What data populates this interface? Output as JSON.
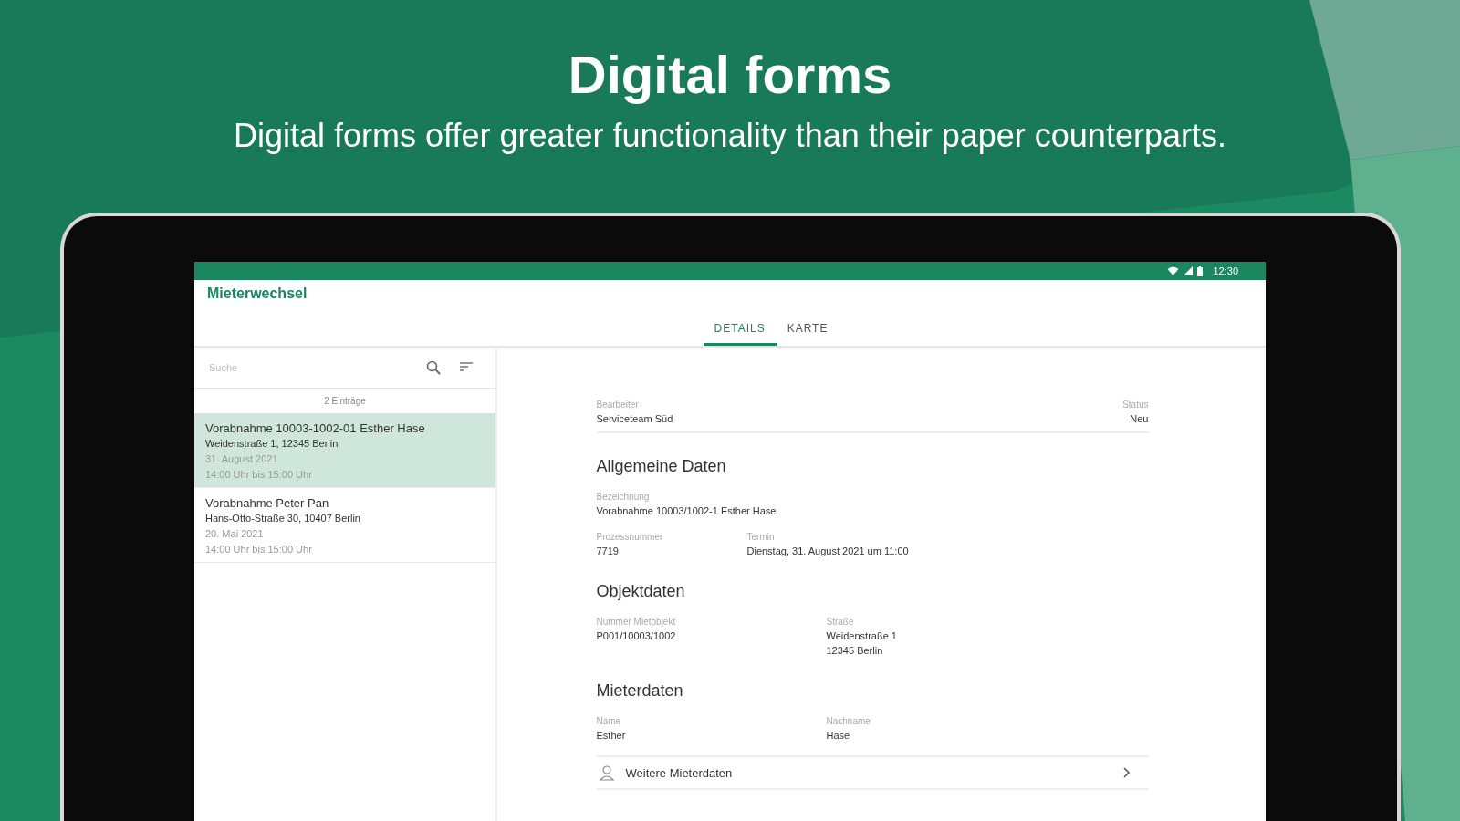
{
  "headline": {
    "title": "Digital forms",
    "subtitle": "Digital forms offer greater functionality than their paper counterparts."
  },
  "status_bar": {
    "time": "12:30"
  },
  "app_bar": {
    "title": "Mieterwechsel"
  },
  "tabs": [
    {
      "label": "DETAILS",
      "selected": true
    },
    {
      "label": "KARTE",
      "selected": false
    }
  ],
  "search": {
    "placeholder": "Suche"
  },
  "list": {
    "count": "2 Einträge",
    "items": [
      {
        "title": "Vorabnahme 10003-1002-01 Esther Hase",
        "address": "Weidenstraße 1, 12345 Berlin",
        "date": "31. August 2021",
        "time": "14:00 Uhr bis 15:00 Uhr",
        "selected": true
      },
      {
        "title": "Vorabnahme Peter Pan",
        "address": "Hans-Otto-Straße 30, 10407 Berlin",
        "date": "20. Mai 2021",
        "time": "14:00 Uhr bis 15:00 Uhr",
        "selected": false
      }
    ]
  },
  "details": {
    "header": [
      {
        "label": "Bearbeiter",
        "value": "Serviceteam Süd"
      },
      {
        "label": "Status",
        "value": "Neu"
      }
    ],
    "sections": [
      {
        "title": "Allgemeine Daten",
        "rows": [
          [
            {
              "label": "Bezeichnung",
              "value": "Vorabnahme 10003/1002-1 Esther Hase"
            }
          ],
          [
            {
              "label": "Prozessnummer",
              "value": "7719"
            },
            {
              "label": "Termin",
              "value": "Dienstag, 31. August 2021 um 11:00"
            }
          ]
        ]
      },
      {
        "title": "Objektdaten",
        "rows": [
          [
            {
              "label": "Nummer Mietobjekt",
              "value": "P001/10003/1002"
            },
            {
              "label": "Straße",
              "value": "Weidenstraße 1\n12345 Berlin"
            }
          ]
        ]
      },
      {
        "title": "Mieterdaten",
        "rows": [
          [
            {
              "label": "Name",
              "value": "Esther"
            },
            {
              "label": "Nachname",
              "value": "Hase"
            }
          ]
        ]
      }
    ],
    "link": {
      "label": "Weitere Mieterdaten"
    }
  }
}
